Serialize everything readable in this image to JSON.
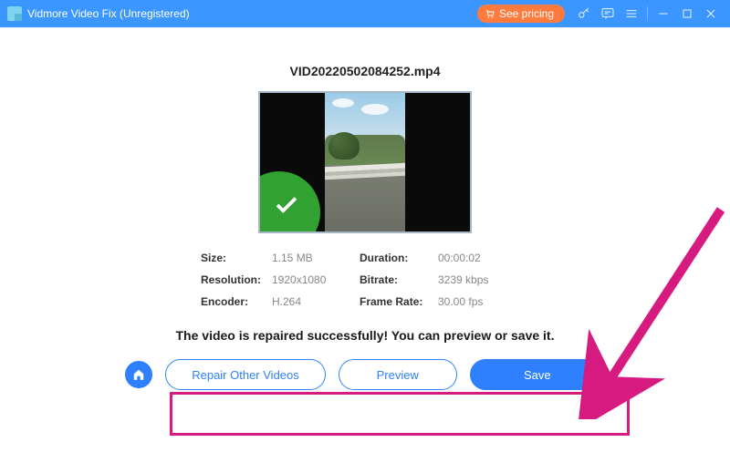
{
  "titlebar": {
    "app_name": "Vidmore Video Fix",
    "registration_state": "(Unregistered)",
    "see_pricing_label": "See pricing"
  },
  "file": {
    "name": "VID20220502084252.mp4"
  },
  "meta": {
    "size_label": "Size:",
    "size_value": "1.15 MB",
    "duration_label": "Duration:",
    "duration_value": "00:00:02",
    "resolution_label": "Resolution:",
    "resolution_value": "1920x1080",
    "bitrate_label": "Bitrate:",
    "bitrate_value": "3239 kbps",
    "encoder_label": "Encoder:",
    "encoder_value": "H.264",
    "framerate_label": "Frame Rate:",
    "framerate_value": "30.00 fps"
  },
  "status": {
    "success_message": "The video is repaired successfully! You can preview or save it."
  },
  "buttons": {
    "repair_other": "Repair Other Videos",
    "preview": "Preview",
    "save": "Save"
  },
  "colors": {
    "accent": "#2f80ff",
    "titlebar": "#3b96ff",
    "pricing": "#ff7a3d",
    "success": "#31a131",
    "annotation": "#d61a7f"
  }
}
